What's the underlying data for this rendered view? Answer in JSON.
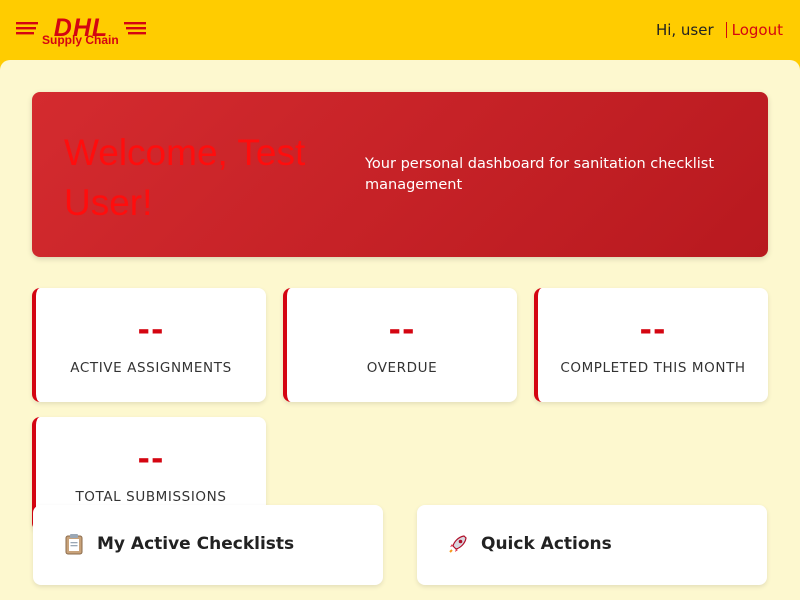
{
  "header": {
    "logo_text": "DHL",
    "logo_subtitle": "Supply Chain",
    "greeting": "Hi, user",
    "logout_label": "Logout"
  },
  "hero": {
    "title": "Welcome, Test User!",
    "subtitle": "Your personal dashboard for sanitation checklist management"
  },
  "stats": [
    {
      "value": "--",
      "label": "ACTIVE ASSIGNMENTS"
    },
    {
      "value": "--",
      "label": "OVERDUE"
    },
    {
      "value": "--",
      "label": "COMPLETED THIS MONTH"
    },
    {
      "value": "--",
      "label": "TOTAL SUBMISSIONS"
    }
  ],
  "panels": [
    {
      "title": "My Active Checklists",
      "icon": "clipboard-icon"
    },
    {
      "title": "Quick Actions",
      "icon": "rocket-icon"
    }
  ],
  "colors": {
    "brand_yellow": "#ffcc00",
    "brand_red": "#d40511",
    "page_background": "#fdf8cf"
  }
}
